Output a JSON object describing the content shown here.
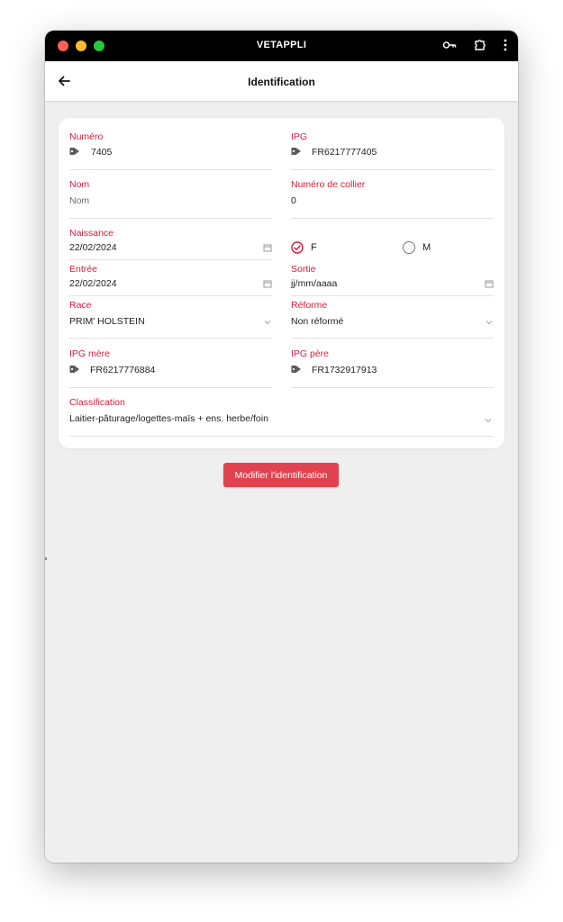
{
  "window": {
    "app_title": "VETAPPLI",
    "traffic_colors": [
      "#fe5f57",
      "#febc2e",
      "#28c840"
    ]
  },
  "header": {
    "title": "Identification"
  },
  "form": {
    "numero": {
      "label": "Numéro",
      "value": "7405"
    },
    "ipg": {
      "label": "IPG",
      "value": "FR6217777405"
    },
    "nom": {
      "label": "Nom",
      "placeholder": "Nom"
    },
    "numero_collier": {
      "label": "Numéro de collier",
      "value": "0"
    },
    "naissance": {
      "label": "Naissance",
      "value": "22/02/2024"
    },
    "sexe": {
      "options": [
        {
          "label": "F",
          "selected": true
        },
        {
          "label": "M",
          "selected": false
        }
      ]
    },
    "entree": {
      "label": "Entrée",
      "value": "22/02/2024"
    },
    "sortie": {
      "label": "Sortie",
      "placeholder": "jj/mm/aaaa"
    },
    "race": {
      "label": "Race",
      "value": "PRIM' HOLSTEIN"
    },
    "reforme": {
      "label": "Réforme",
      "value": "Non réformé"
    },
    "ipg_mere": {
      "label": "IPG mère",
      "value": "FR6217776884"
    },
    "ipg_pere": {
      "label": "IPG père",
      "value": "FR1732917913"
    },
    "classification": {
      "label": "Classification",
      "value": "Laitier-pâturage/logettes-maïs + ens. herbe/foin"
    }
  },
  "actions": {
    "modify_label": "Modifier l'identification"
  },
  "colors": {
    "accent": "#d81b3c",
    "button": "#e0424f",
    "background": "#efefef"
  },
  "icons": {
    "back": "arrow-left-icon",
    "tag": "tag-icon",
    "calendar": "calendar-icon",
    "dropdown": "chevron-down-icon",
    "key": "key-icon",
    "extension": "puzzle-icon",
    "menu": "more-vertical-icon"
  }
}
